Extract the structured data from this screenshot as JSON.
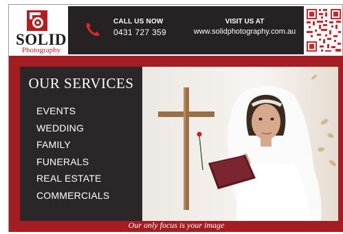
{
  "brand": {
    "name": "SOLID",
    "subtitle": "Photography"
  },
  "header": {
    "call_label": "CALL US NOW",
    "phone": "0431 727 359",
    "visit_label": "VISIT US AT",
    "website": "www.solidphotography.com.au"
  },
  "services": {
    "title": "OUR SERVICES",
    "items": [
      "EVENTS",
      "WEDDING",
      "FAMILY",
      "FUNERALS",
      "REAL ESTATE",
      "COMMERCIALS"
    ]
  },
  "footer": {
    "tagline": "Our only focus is your image"
  },
  "colors": {
    "brand_red": "#a31d22",
    "dark_panel": "#2b2627",
    "header_dark": "#262122"
  },
  "icons": {
    "phone": "phone-icon",
    "logo": "camera-logo-icon",
    "qr": "qr-code-icon"
  }
}
